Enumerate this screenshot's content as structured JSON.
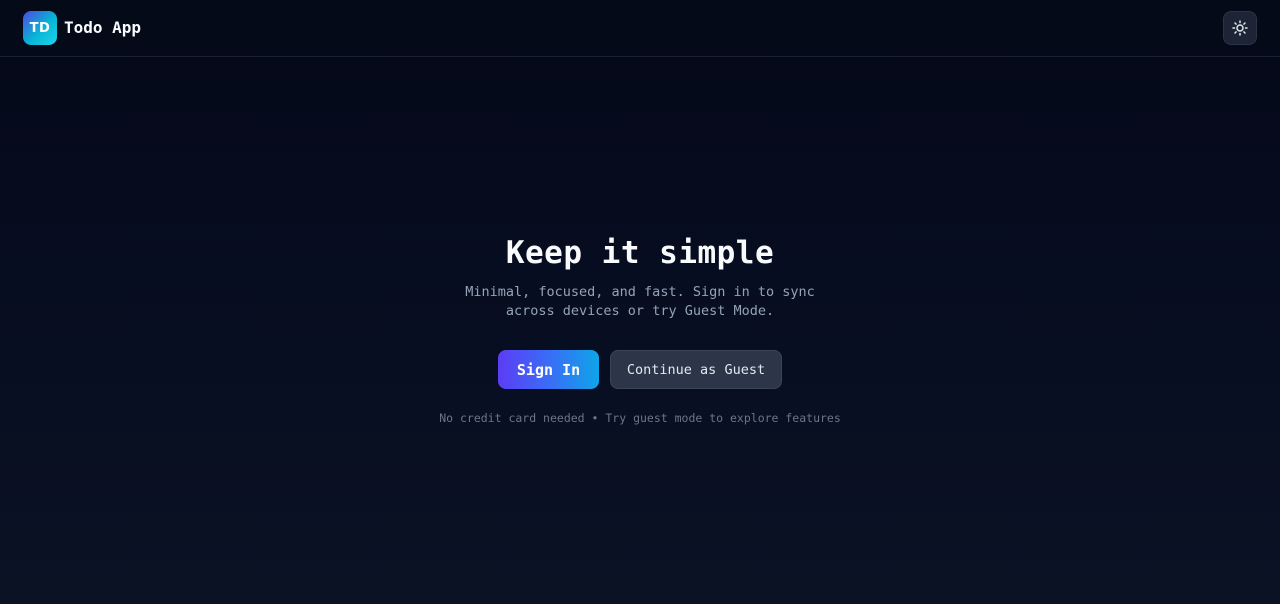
{
  "header": {
    "logo_text": "TD",
    "app_title": "Todo App",
    "theme_toggle_icon": "sun-icon"
  },
  "hero": {
    "title": "Keep it simple",
    "subtitle_line1": "Minimal, focused, and fast. Sign in to sync",
    "subtitle_line2": "across devices or try Guest Mode.",
    "signin_label": "Sign In",
    "guest_label": "Continue as Guest",
    "footnote": "No credit card needed • Try guest mode to explore features"
  },
  "colors": {
    "background": "#040818",
    "accent_start": "#5b3df5",
    "accent_end": "#0ea5e9",
    "secondary_button": "#2c3648",
    "muted_text": "#94a3b8"
  }
}
